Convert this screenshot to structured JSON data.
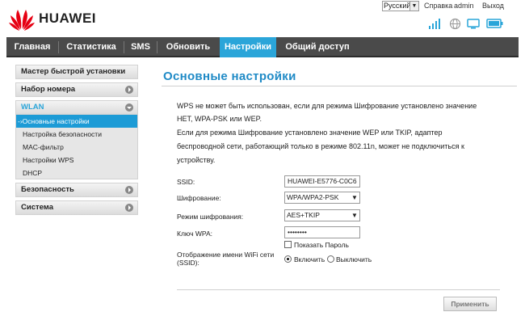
{
  "brand": {
    "name": "HUAWEI",
    "accent": "#2aa5d9",
    "logo_color": "#e60012"
  },
  "header": {
    "language": "Русский",
    "help": "Справка",
    "user": "admin",
    "logout": "Выход",
    "status_icons": [
      "signal-strength-icon",
      "globe-icon",
      "wifi-device-icon",
      "battery-icon"
    ]
  },
  "nav": {
    "items": [
      {
        "label": "Главная"
      },
      {
        "label": "Статистика"
      },
      {
        "label": "SMS"
      },
      {
        "label": "Обновить"
      },
      {
        "label": "Настройки",
        "active": true
      },
      {
        "label": "Общий доступ"
      }
    ]
  },
  "sidebar": {
    "quick_setup": "Мастер быстрой установки",
    "dial": "Набор номера",
    "wlan": "WLAN",
    "wlan_items": [
      {
        "label": "-›Основные настройки",
        "active": true
      },
      {
        "label": "Настройка безопасности"
      },
      {
        "label": "MAC-фильтр"
      },
      {
        "label": "Настройки WPS"
      },
      {
        "label": "DHCP"
      }
    ],
    "security": "Безопасность",
    "system": "Система"
  },
  "main": {
    "title": "Основные настройки",
    "info_lines": [
      "WPS не может быть использован, если для режима Шифрование установлено значение",
      "НЕТ, WPA-PSK или WEP.",
      "Если для режима Шифрование установлено значение WEP или TKIP, адаптер",
      "беспроводной сети, работающий только в режиме 802.11n, может не подключиться к",
      "устройству."
    ],
    "form": {
      "ssid_label": "SSID:",
      "ssid_value": "HUAWEI-E5776-C0C6",
      "encryption_label": "Шифрование:",
      "encryption_value": "WPA/WPA2-PSK",
      "encryption_mode_label": "Режим шифрования:",
      "encryption_mode_value": "AES+TKIP",
      "wpa_key_label": "Ключ WPA:",
      "wpa_key_value": "••••••••",
      "show_password_label": "Показать Пароль",
      "show_password_checked": false,
      "ssid_broadcast_label_line1": "Отображение имени WiFi сети",
      "ssid_broadcast_label_line2": "(SSID):",
      "broadcast_on_label": "Включить",
      "broadcast_off_label": "Выключить",
      "broadcast_selected": "on"
    },
    "apply_label": "Применить"
  }
}
